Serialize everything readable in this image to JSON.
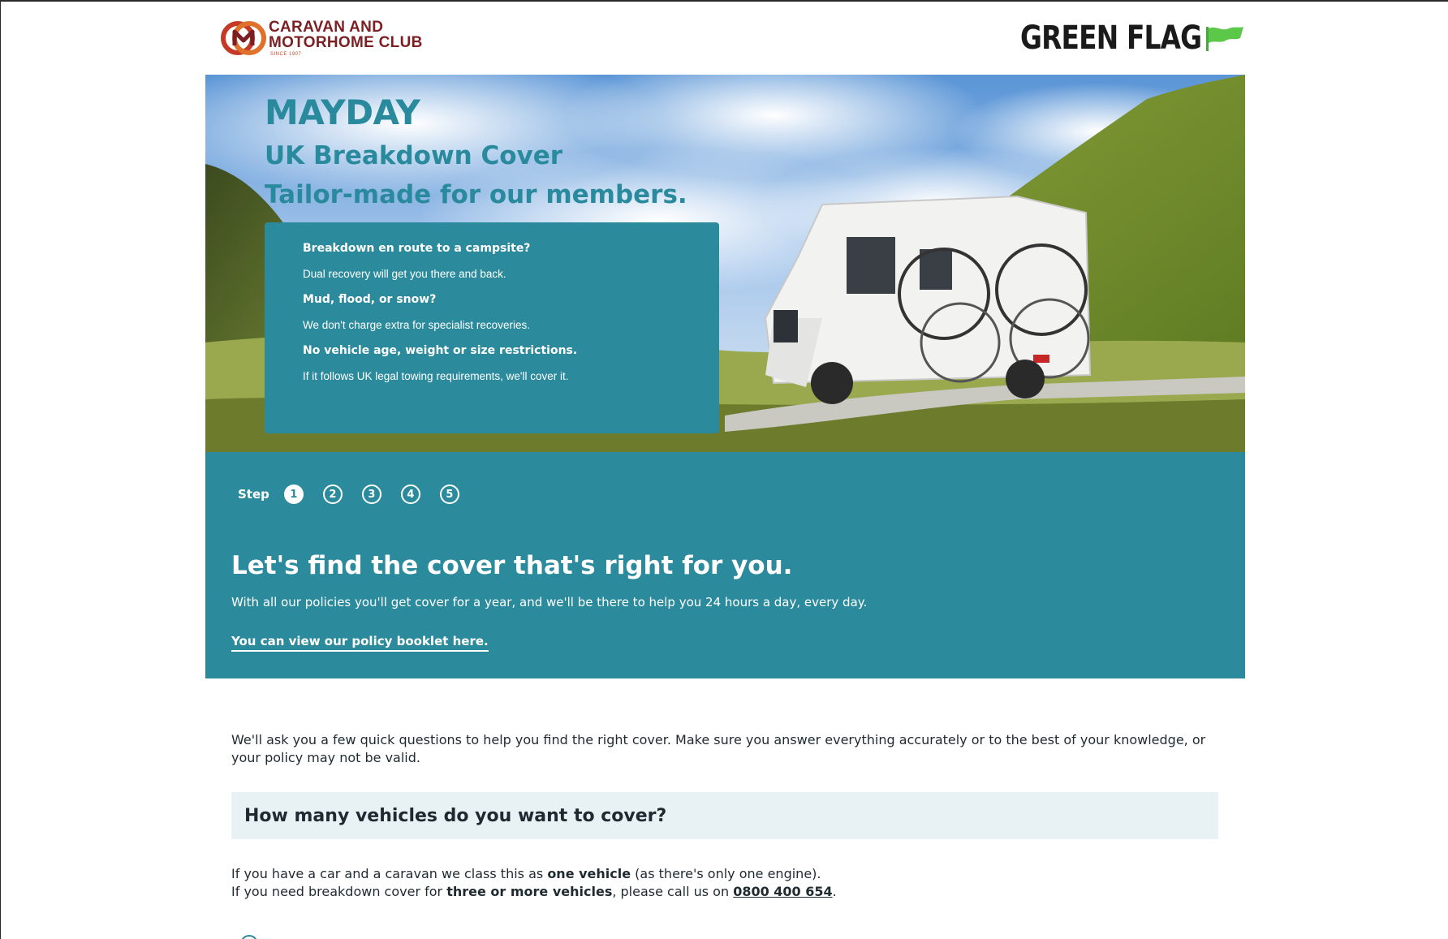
{
  "header": {
    "cmc_logo_line1": "CARAVAN AND",
    "cmc_logo_line2": "MOTORHOME CLUB",
    "cmc_logo_since": "SINCE 1907",
    "gf_logo_text": "GREEN FLAG",
    "gf_flag_icon": "green-flag-icon"
  },
  "hero": {
    "title": "MAYDAY",
    "subtitle1": "UK Breakdown Cover",
    "subtitle2": "Tailor-made for our members.",
    "features": [
      {
        "heading": "Breakdown en route to a campsite?",
        "body": "Dual recovery will get you there and back."
      },
      {
        "heading": "Mud, flood, or snow?",
        "body": "We don't charge extra for specialist recoveries."
      },
      {
        "heading": "No vehicle age, weight or size restrictions.",
        "body": "If it follows UK legal towing requirements, we'll cover it."
      }
    ]
  },
  "steps": {
    "label": "Step",
    "items": [
      "1",
      "2",
      "3",
      "4",
      "5"
    ],
    "active": 1
  },
  "intro_section": {
    "heading": "Let's find the cover that's right for you.",
    "paragraph": "With all our policies you'll get cover for a year, and we'll be there to help you 24 hours a day, every day.",
    "link": "You can view our policy booklet here."
  },
  "body": {
    "intro_text": "We'll ask you a few quick questions to help you find the right cover. Make sure you answer everything accurately or to the best of your knowledge, or your policy may not be valid.",
    "question": "How many vehicles do you want to cover?",
    "info_line1_pre": "If you have a car and a caravan we class this as ",
    "info_line1_bold": "one vehicle",
    "info_line1_post": " (as there's only one engine).",
    "info_line2_pre": "If you need breakdown cover for ",
    "info_line2_bold": "three or more vehicles",
    "info_line2_mid": ", please call us on ",
    "info_line2_phone": "0800 400 654",
    "info_line2_post": "."
  },
  "colors": {
    "teal": "#2b8a9c",
    "teal_text": "#2a8a9d",
    "brand_red": "#7b1f23",
    "green_flag": "#5cc84a",
    "question_bg": "#e8f1f3"
  }
}
